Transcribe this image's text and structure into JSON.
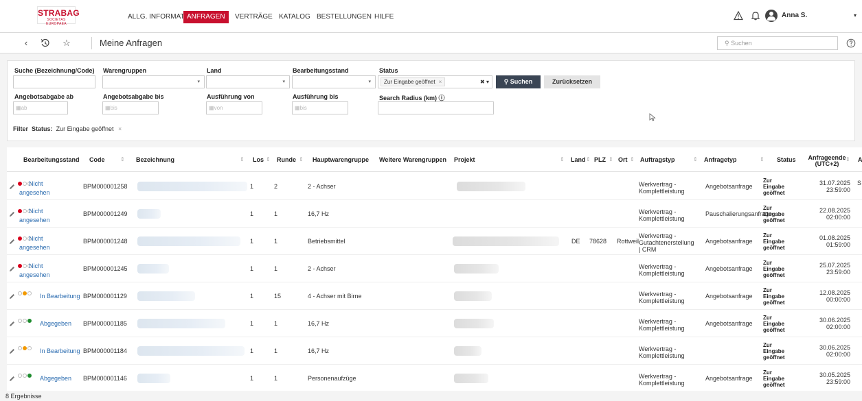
{
  "header": {
    "logo_main": "STRABAG",
    "logo_sub": "SOCIETAS EUROPAEA",
    "nav": [
      {
        "label": "ALLG. INFORMATIONEN",
        "active": false
      },
      {
        "label": "ANFRAGEN",
        "active": true
      },
      {
        "label": "VERTRÄGE",
        "active": false
      },
      {
        "label": "KATALOG",
        "active": false
      },
      {
        "label": "BESTELLUNGEN",
        "active": false
      },
      {
        "label": "HILFE",
        "active": false
      }
    ],
    "user_name": "Anna S."
  },
  "subbar": {
    "page_title": "Meine Anfragen",
    "search_placeholder": "Suchen"
  },
  "filters": {
    "search_label": "Suche (Bezeichnung/Code)",
    "warengruppen_label": "Warengruppen",
    "land_label": "Land",
    "bearbeitungsstand_label": "Bearbeitungsstand",
    "status_label": "Status",
    "status_chip": "Zur Eingabe geöffnet",
    "search_button": "Suchen",
    "reset_button": "Zurücksetzen",
    "angebot_ab_label": "Angebotsabgabe ab",
    "angebot_ab_placeholder": "ab",
    "angebot_bis_label": "Angebotsabgabe bis",
    "angebot_bis_placeholder": "bis",
    "ausf_von_label": "Ausführung von",
    "ausf_von_placeholder": "von",
    "ausf_bis_label": "Ausführung bis",
    "ausf_bis_placeholder": "bis",
    "radius_label": "Search Radius (km)",
    "summary_prefix": "Filter",
    "summary_key": "Status:",
    "summary_value": "Zur Eingabe geöffnet"
  },
  "table": {
    "columns": {
      "bearbeitungsstand": "Bearbeitungsstand",
      "code": "Code",
      "bezeichnung": "Bezeichnung",
      "los": "Los",
      "runde": "Runde",
      "hauptwarengruppe": "Hauptwarengruppe",
      "weitere": "Weitere Warengruppen",
      "projekt": "Projekt",
      "land": "Land",
      "plz": "PLZ",
      "ort": "Ort",
      "auftragstyp": "Auftragstyp",
      "anfragetyp": "Anfragetyp",
      "status": "Status",
      "anfrageende_1": "Anfrageende",
      "anfrageende_2": "(UTC+2)",
      "last_partial": "A"
    },
    "rows": [
      {
        "stand_1": "Nicht",
        "stand_2": "angesehen",
        "dots": "red",
        "code": "BPM000001258",
        "los": "1",
        "runde": "2",
        "hwg": "2 - Achser",
        "land": "",
        "plz": "",
        "ort": "",
        "auft_1": "Werkvertrag -",
        "auft_2": "Komplettleistung",
        "auft_3": "",
        "anfragetyp": "Angebotsanfrage",
        "status_1": "Zur",
        "status_2": "Eingabe",
        "status_3": "geöffnet",
        "date": "31.07.2025",
        "time": "23:59:00",
        "extra": "S"
      },
      {
        "stand_1": "Nicht",
        "stand_2": "angesehen",
        "dots": "red",
        "code": "BPM000001249",
        "los": "1",
        "runde": "1",
        "hwg": "16,7 Hz",
        "land": "",
        "plz": "",
        "ort": "",
        "auft_1": "Werkvertrag -",
        "auft_2": "Komplettleistung",
        "auft_3": "",
        "anfragetyp": "Pauschalierungsanfrage",
        "status_1": "Zur",
        "status_2": "Eingabe",
        "status_3": "geöffnet",
        "date": "22.08.2025",
        "time": "02:00:00",
        "extra": ""
      },
      {
        "stand_1": "Nicht",
        "stand_2": "angesehen",
        "dots": "red",
        "code": "BPM000001248",
        "los": "1",
        "runde": "1",
        "hwg": "Betriebsmittel",
        "land": "DE",
        "plz": "78628",
        "ort": "Rottweil",
        "auft_1": "Werkvertrag -",
        "auft_2": "Gutachtenerstellung",
        "auft_3": "| CRM",
        "anfragetyp": "Angebotsanfrage",
        "status_1": "Zur",
        "status_2": "Eingabe",
        "status_3": "geöffnet",
        "date": "01.08.2025",
        "time": "01:59:00",
        "extra": ""
      },
      {
        "stand_1": "Nicht",
        "stand_2": "angesehen",
        "dots": "red",
        "code": "BPM000001245",
        "los": "1",
        "runde": "1",
        "hwg": "2 - Achser",
        "land": "",
        "plz": "",
        "ort": "",
        "auft_1": "Werkvertrag -",
        "auft_2": "Komplettleistung",
        "auft_3": "",
        "anfragetyp": "Angebotsanfrage",
        "status_1": "Zur",
        "status_2": "Eingabe",
        "status_3": "geöffnet",
        "date": "25.07.2025",
        "time": "23:59:00",
        "extra": ""
      },
      {
        "stand_1": "In Bearbeitung",
        "stand_2": "",
        "dots": "orange",
        "code": "BPM000001129",
        "los": "1",
        "runde": "15",
        "hwg": "4 - Achser mit Birne",
        "land": "",
        "plz": "",
        "ort": "",
        "auft_1": "Werkvertrag -",
        "auft_2": "Komplettleistung",
        "auft_3": "",
        "anfragetyp": "Angebotsanfrage",
        "status_1": "Zur",
        "status_2": "Eingabe",
        "status_3": "geöffnet",
        "date": "12.08.2025",
        "time": "00:00:00",
        "extra": ""
      },
      {
        "stand_1": "Abgegeben",
        "stand_2": "",
        "dots": "green",
        "code": "BPM000001185",
        "los": "1",
        "runde": "1",
        "hwg": "16,7 Hz",
        "land": "",
        "plz": "",
        "ort": "",
        "auft_1": "Werkvertrag -",
        "auft_2": "Komplettleistung",
        "auft_3": "",
        "anfragetyp": "Angebotsanfrage",
        "status_1": "Zur",
        "status_2": "Eingabe",
        "status_3": "geöffnet",
        "date": "30.06.2025",
        "time": "02:00:00",
        "extra": ""
      },
      {
        "stand_1": "In Bearbeitung",
        "stand_2": "",
        "dots": "orange",
        "code": "BPM000001184",
        "los": "1",
        "runde": "1",
        "hwg": "16,7 Hz",
        "land": "",
        "plz": "",
        "ort": "",
        "auft_1": "Werkvertrag -",
        "auft_2": "Komplettleistung",
        "auft_3": "",
        "anfragetyp": "",
        "status_1": "Zur",
        "status_2": "Eingabe",
        "status_3": "geöffnet",
        "date": "30.06.2025",
        "time": "02:00:00",
        "extra": ""
      },
      {
        "stand_1": "Abgegeben",
        "stand_2": "",
        "dots": "green",
        "code": "BPM000001146",
        "los": "1",
        "runde": "1",
        "hwg": "Personenaufzüge",
        "land": "",
        "plz": "",
        "ort": "",
        "auft_1": "Werkvertrag -",
        "auft_2": "Komplettleistung",
        "auft_3": "",
        "anfragetyp": "Angebotsanfrage",
        "status_1": "Zur",
        "status_2": "Eingabe",
        "status_3": "geöffnet",
        "date": "30.05.2025",
        "time": "23:59:00",
        "extra": ""
      }
    ],
    "result_count": "8 Ergebnisse"
  }
}
